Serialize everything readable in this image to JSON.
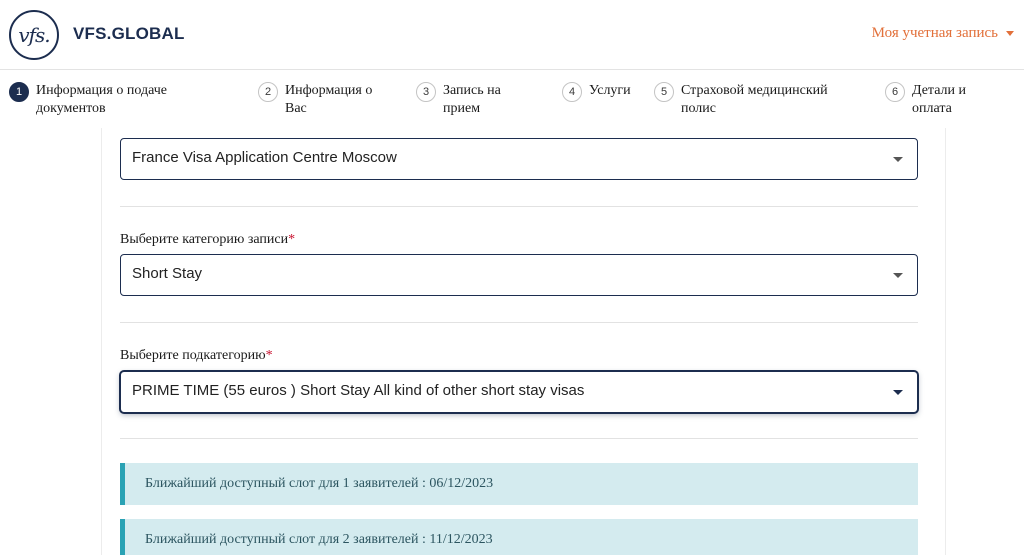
{
  "header": {
    "logo_text": "vfs.",
    "brand": "VFS.GLOBAL",
    "account_label": "Моя учетная запись",
    "accent_color": "#e2703a"
  },
  "stepper": {
    "steps": [
      {
        "num": "1",
        "label": "Информация о подаче документов",
        "active": true
      },
      {
        "num": "2",
        "label": "Информация о Вас"
      },
      {
        "num": "3",
        "label": "Запись на прием"
      },
      {
        "num": "4",
        "label": "Услуги"
      },
      {
        "num": "5",
        "label": "Страховой медицинский полис"
      },
      {
        "num": "6",
        "label": "Детали и оплата"
      }
    ]
  },
  "form": {
    "centre_select": {
      "value": "France Visa Application Centre Moscow"
    },
    "category": {
      "label": "Выберите категорию записи",
      "required_mark": "*",
      "value": "Short Stay"
    },
    "subcategory": {
      "label": "Выберите подкатегорию",
      "required_mark": "*",
      "value": "PRIME TIME (55 euros ) Short Stay All kind of other short stay visas"
    }
  },
  "slots": [
    {
      "text": "Ближайший доступный слот для 1 заявителей : 06/12/2023"
    },
    {
      "text": "Ближайший доступный слот для 2 заявителей : 11/12/2023"
    }
  ],
  "colors": {
    "primary": "#1c2d4f",
    "alert_bg": "#d4ebef",
    "alert_border": "#2aa2b4",
    "required": "#c8102e"
  }
}
